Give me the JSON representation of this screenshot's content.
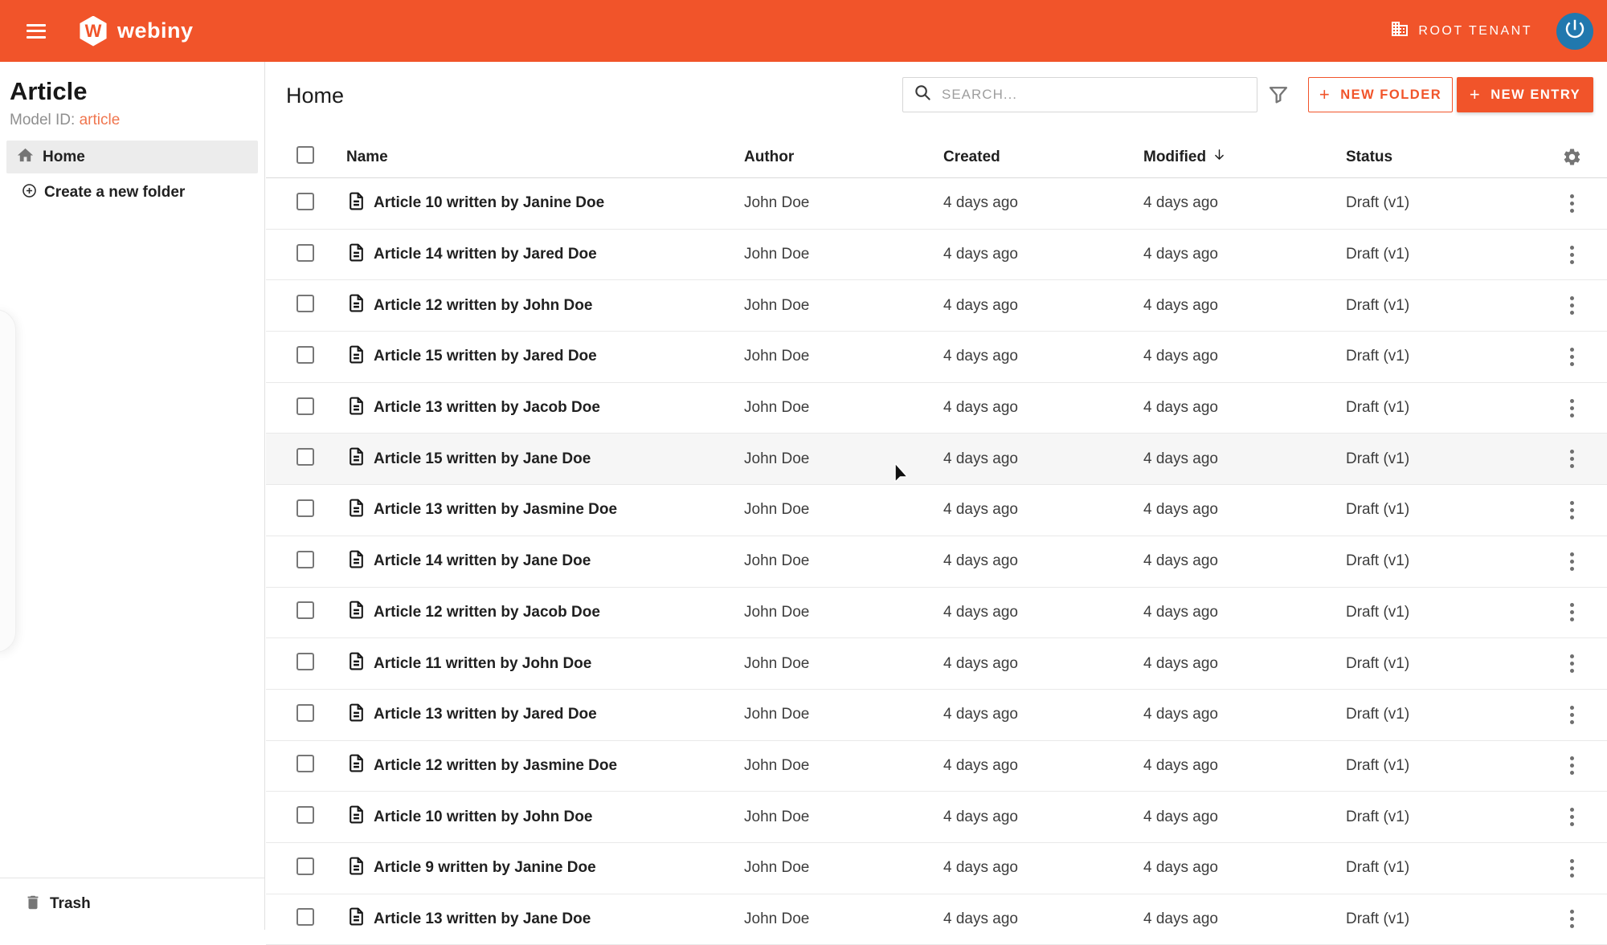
{
  "topbar": {
    "brand": "webiny",
    "brand_letter": "W",
    "tenant_label": "ROOT TENANT"
  },
  "sidebar": {
    "title": "Article",
    "model_id_label": "Model ID: ",
    "model_id_value": "article",
    "home_label": "Home",
    "new_folder_label": "Create a new folder",
    "trash_label": "Trash"
  },
  "toolbar": {
    "breadcrumb": "Home",
    "search_placeholder": "SEARCH...",
    "new_folder_label": "NEW FOLDER",
    "new_entry_label": "NEW ENTRY",
    "plus_glyph": "+"
  },
  "table": {
    "columns": {
      "name": "Name",
      "author": "Author",
      "created": "Created",
      "modified": "Modified",
      "status": "Status"
    },
    "sort": {
      "column": "Modified",
      "direction": "desc"
    },
    "rows": [
      {
        "name": "Article 10 written by Janine Doe",
        "author": "John Doe",
        "created": "4 days ago",
        "modified": "4 days ago",
        "status": "Draft (v1)",
        "hovered": false
      },
      {
        "name": "Article 14 written by Jared Doe",
        "author": "John Doe",
        "created": "4 days ago",
        "modified": "4 days ago",
        "status": "Draft (v1)",
        "hovered": false
      },
      {
        "name": "Article 12 written by John Doe",
        "author": "John Doe",
        "created": "4 days ago",
        "modified": "4 days ago",
        "status": "Draft (v1)",
        "hovered": false
      },
      {
        "name": "Article 15 written by Jared Doe",
        "author": "John Doe",
        "created": "4 days ago",
        "modified": "4 days ago",
        "status": "Draft (v1)",
        "hovered": false
      },
      {
        "name": "Article 13 written by Jacob Doe",
        "author": "John Doe",
        "created": "4 days ago",
        "modified": "4 days ago",
        "status": "Draft (v1)",
        "hovered": false
      },
      {
        "name": "Article 15 written by Jane Doe",
        "author": "John Doe",
        "created": "4 days ago",
        "modified": "4 days ago",
        "status": "Draft (v1)",
        "hovered": true
      },
      {
        "name": "Article 13 written by Jasmine Doe",
        "author": "John Doe",
        "created": "4 days ago",
        "modified": "4 days ago",
        "status": "Draft (v1)",
        "hovered": false
      },
      {
        "name": "Article 14 written by Jane Doe",
        "author": "John Doe",
        "created": "4 days ago",
        "modified": "4 days ago",
        "status": "Draft (v1)",
        "hovered": false
      },
      {
        "name": "Article 12 written by Jacob Doe",
        "author": "John Doe",
        "created": "4 days ago",
        "modified": "4 days ago",
        "status": "Draft (v1)",
        "hovered": false
      },
      {
        "name": "Article 11 written by John Doe",
        "author": "John Doe",
        "created": "4 days ago",
        "modified": "4 days ago",
        "status": "Draft (v1)",
        "hovered": false
      },
      {
        "name": "Article 13 written by Jared Doe",
        "author": "John Doe",
        "created": "4 days ago",
        "modified": "4 days ago",
        "status": "Draft (v1)",
        "hovered": false
      },
      {
        "name": "Article 12 written by Jasmine Doe",
        "author": "John Doe",
        "created": "4 days ago",
        "modified": "4 days ago",
        "status": "Draft (v1)",
        "hovered": false
      },
      {
        "name": "Article 10 written by John Doe",
        "author": "John Doe",
        "created": "4 days ago",
        "modified": "4 days ago",
        "status": "Draft (v1)",
        "hovered": false
      },
      {
        "name": "Article 9 written by Janine Doe",
        "author": "John Doe",
        "created": "4 days ago",
        "modified": "4 days ago",
        "status": "Draft (v1)",
        "hovered": false
      },
      {
        "name": "Article 13 written by Jane Doe",
        "author": "John Doe",
        "created": "4 days ago",
        "modified": "4 days ago",
        "status": "Draft (v1)",
        "hovered": false
      }
    ]
  },
  "colors": {
    "accent": "#f1542a",
    "avatar_blue": "#2178ae",
    "model_id_orange": "#f0764f",
    "selected_nav_bg": "#ececec",
    "hovered_row_bg": "#f6f6f6"
  }
}
